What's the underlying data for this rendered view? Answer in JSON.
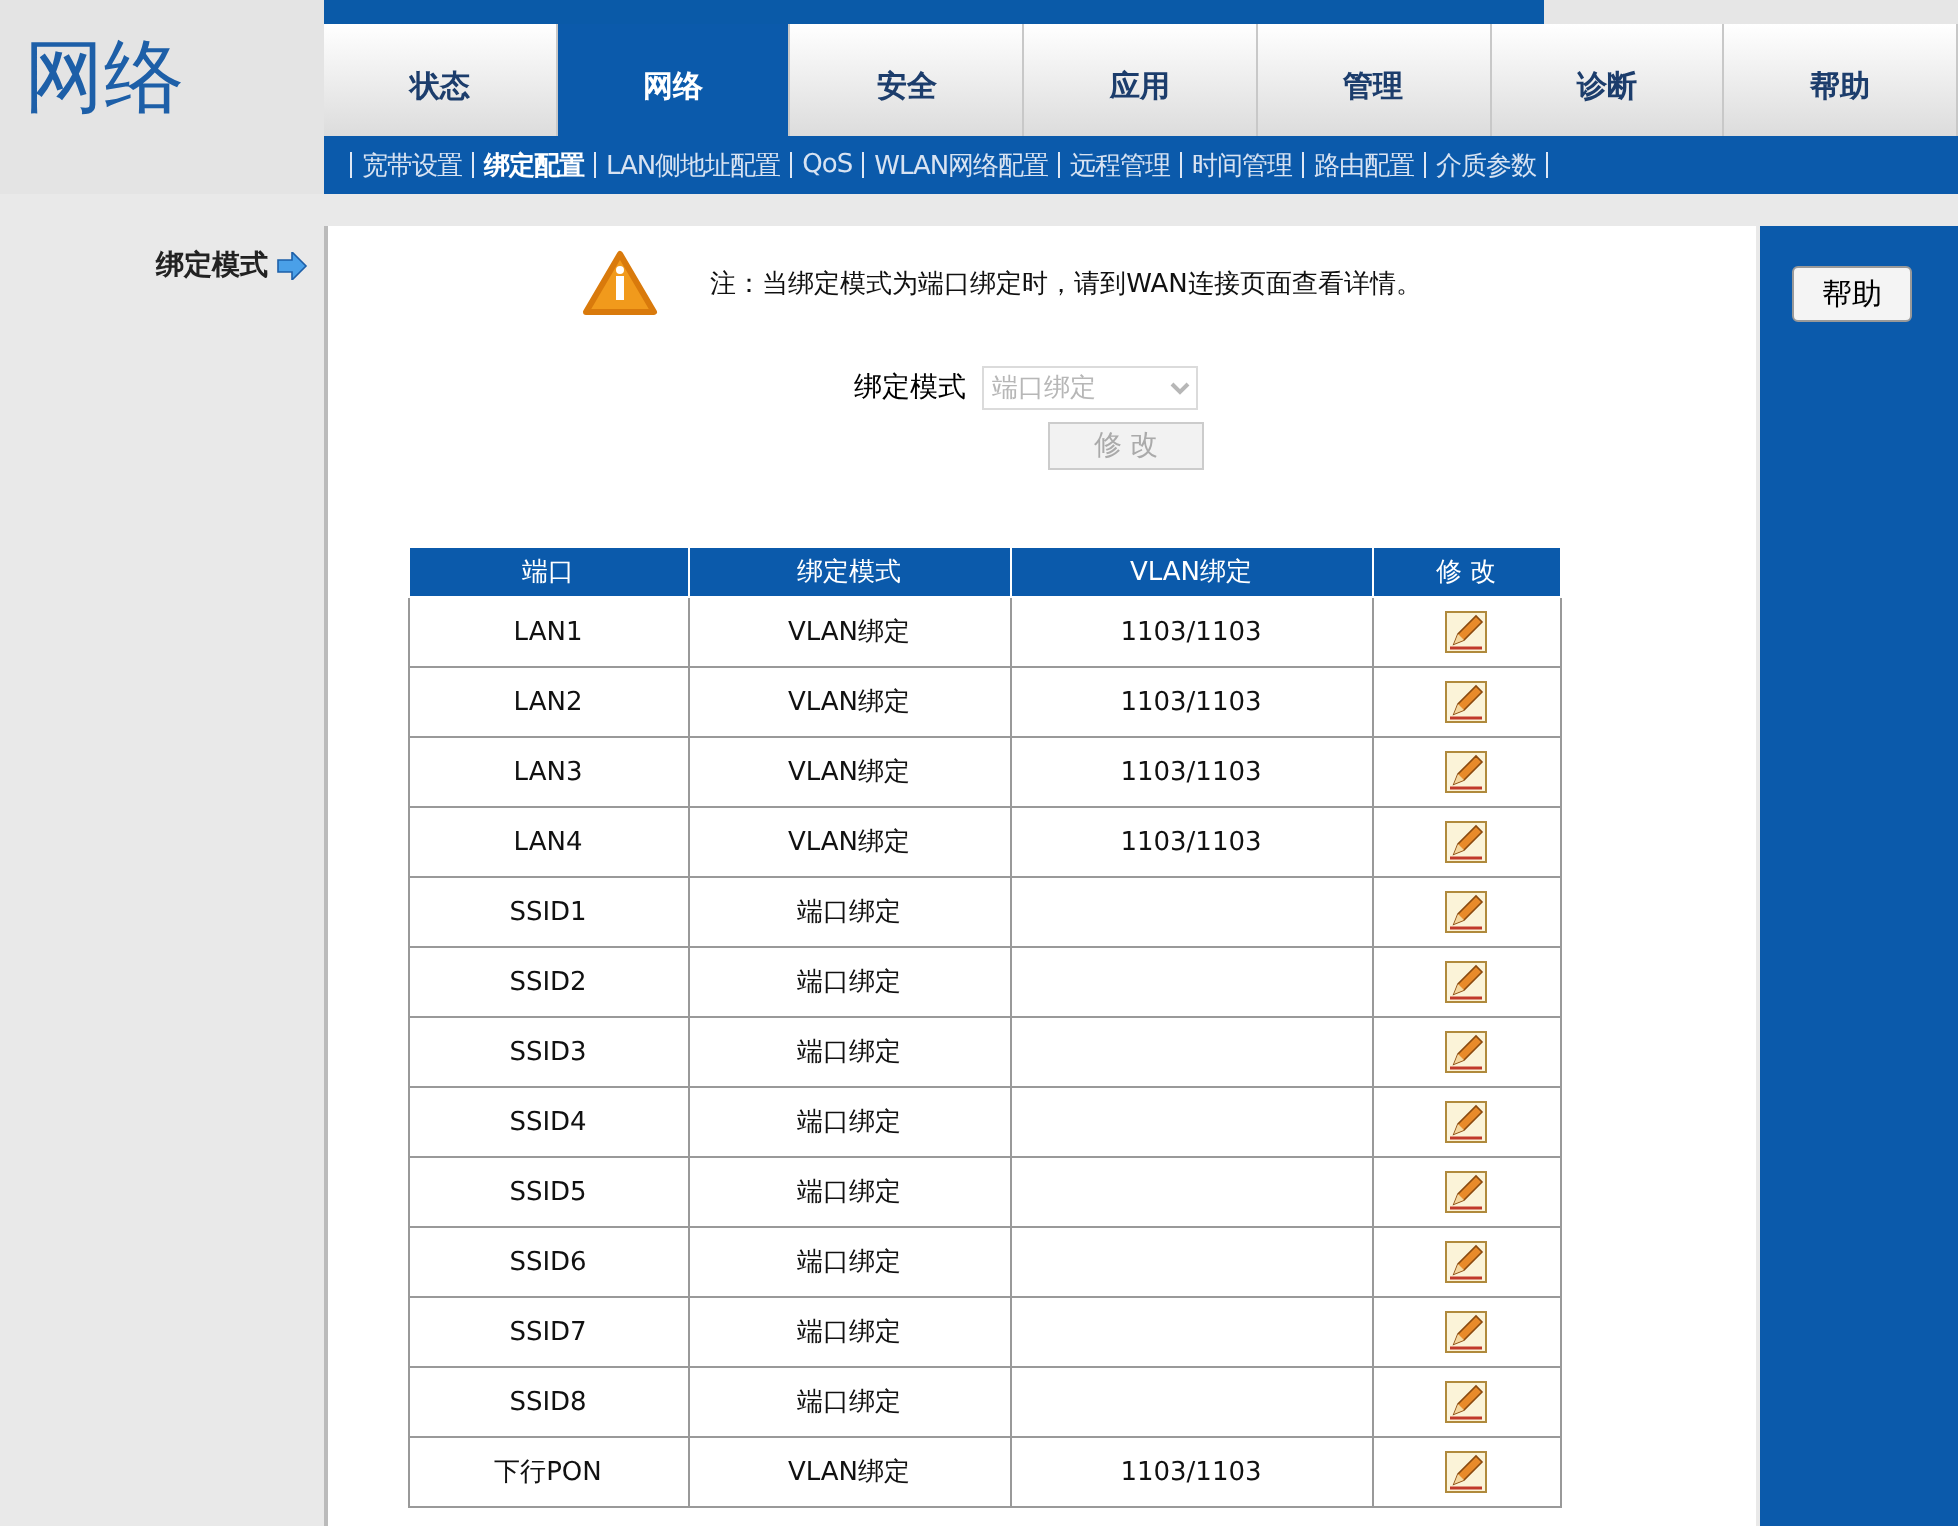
{
  "header": {
    "title": "网络"
  },
  "tabs": [
    {
      "label": "状态",
      "selected": false
    },
    {
      "label": "网络",
      "selected": true
    },
    {
      "label": "安全",
      "selected": false
    },
    {
      "label": "应用",
      "selected": false
    },
    {
      "label": "管理",
      "selected": false
    },
    {
      "label": "诊断",
      "selected": false
    },
    {
      "label": "帮助",
      "selected": false
    }
  ],
  "subnav": [
    {
      "label": "宽带设置",
      "selected": false
    },
    {
      "label": "绑定配置",
      "selected": true
    },
    {
      "label": "LAN侧地址配置",
      "selected": false
    },
    {
      "label": "QoS",
      "selected": false
    },
    {
      "label": "WLAN网络配置",
      "selected": false
    },
    {
      "label": "远程管理",
      "selected": false
    },
    {
      "label": "时间管理",
      "selected": false
    },
    {
      "label": "路由配置",
      "selected": false
    },
    {
      "label": "介质参数",
      "selected": false
    }
  ],
  "sidebar": {
    "items": [
      {
        "label": "绑定模式",
        "selected": true
      }
    ]
  },
  "notice": "注：当绑定模式为端口绑定时，请到WAN连接页面查看详情。",
  "mode_field": {
    "label": "绑定模式",
    "value": "端口绑定",
    "disabled": true
  },
  "modify_button": {
    "label": "修 改",
    "disabled": true
  },
  "table": {
    "columns": [
      "端口",
      "绑定模式",
      "VLAN绑定",
      "修 改"
    ],
    "rows": [
      {
        "port": "LAN1",
        "mode": "VLAN绑定",
        "vlan": "1103/1103"
      },
      {
        "port": "LAN2",
        "mode": "VLAN绑定",
        "vlan": "1103/1103"
      },
      {
        "port": "LAN3",
        "mode": "VLAN绑定",
        "vlan": "1103/1103"
      },
      {
        "port": "LAN4",
        "mode": "VLAN绑定",
        "vlan": "1103/1103"
      },
      {
        "port": "SSID1",
        "mode": "端口绑定"
      },
      {
        "port": "SSID2",
        "mode": "端口绑定"
      },
      {
        "port": "SSID3",
        "mode": "端口绑定"
      },
      {
        "port": "SSID4",
        "mode": "端口绑定"
      },
      {
        "port": "SSID5",
        "mode": "端口绑定"
      },
      {
        "port": "SSID6",
        "mode": "端口绑定"
      },
      {
        "port": "SSID7",
        "mode": "端口绑定"
      },
      {
        "port": "SSID8",
        "mode": "端口绑定"
      },
      {
        "port": "下行PON",
        "mode": "VLAN绑定",
        "vlan": "1103/1103"
      }
    ]
  },
  "help_button": "帮助"
}
